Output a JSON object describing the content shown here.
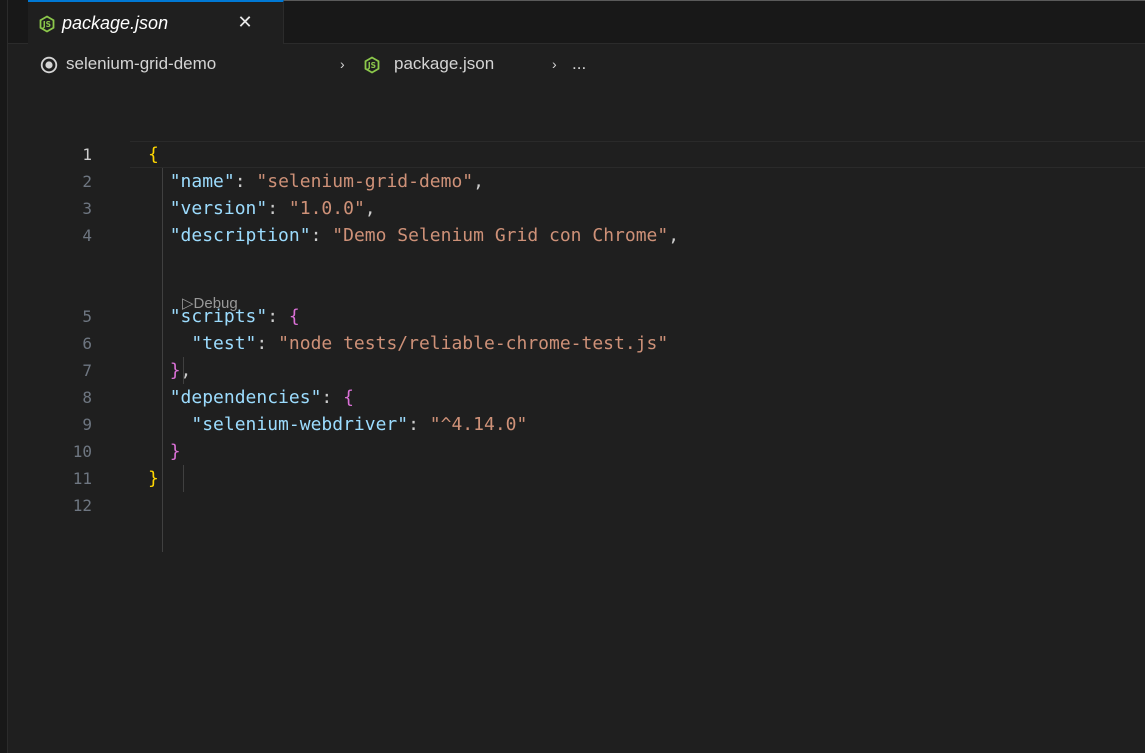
{
  "tab": {
    "label": "package.json",
    "close_glyph": "✕",
    "icon": "nodejs-icon"
  },
  "breadcrumb": {
    "folder": "selenium-grid-demo",
    "file": "package.json",
    "more": "...",
    "separator": "›",
    "folder_icon": "circle-dot-icon",
    "file_icon": "nodejs-icon"
  },
  "codelens": {
    "label": "▷Debug"
  },
  "colors": {
    "key": "#9cdcfe",
    "string": "#ce9178",
    "brace_outer": "#ffd700",
    "brace_inner": "#da70d6",
    "accent": "#0078d4",
    "nodejs": "#8cc84b"
  },
  "code": {
    "line_numbers": [
      "1",
      "2",
      "3",
      "4",
      "5",
      "6",
      "7",
      "8",
      "9",
      "10",
      "11",
      "12"
    ],
    "l1": {
      "brace": "{"
    },
    "l2": {
      "key": "\"name\"",
      "colon": ": ",
      "value": "\"selenium-grid-demo\"",
      "tail": ","
    },
    "l3": {
      "key": "\"version\"",
      "colon": ": ",
      "value": "\"1.0.0\"",
      "tail": ","
    },
    "l4": {
      "key": "\"description\"",
      "colon": ": ",
      "value": "\"Demo Selenium Grid con Chrome\"",
      "tail": ","
    },
    "l5": {
      "key": "\"scripts\"",
      "colon": ": ",
      "brace": "{"
    },
    "l6": {
      "key": "\"test\"",
      "colon": ": ",
      "value": "\"node tests/reliable-chrome-test.js\""
    },
    "l7": {
      "brace": "}",
      "tail": ","
    },
    "l8": {
      "key": "\"dependencies\"",
      "colon": ": ",
      "brace": "{"
    },
    "l9": {
      "key": "\"selenium-webdriver\"",
      "colon": ": ",
      "value": "\"^4.14.0\""
    },
    "l10": {
      "brace": "}"
    },
    "l11": {
      "brace": "}"
    }
  }
}
